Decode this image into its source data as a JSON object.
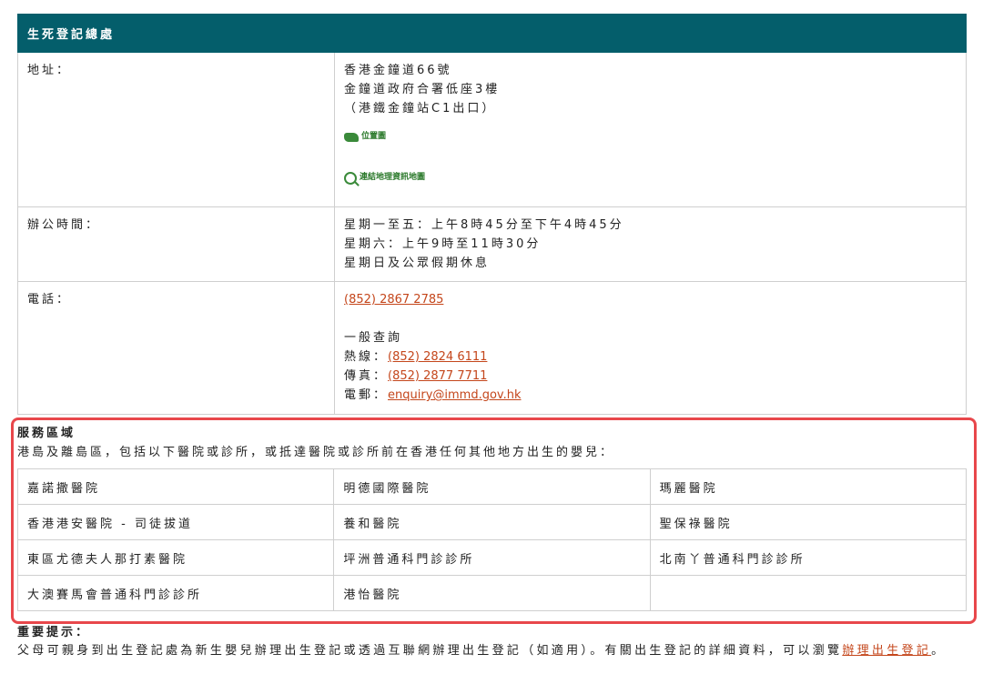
{
  "office": {
    "title": "生死登記總處",
    "address_label": "地址：",
    "address_lines": [
      "香港金鐘道66號",
      "金鐘道政府合署低座3樓",
      "（港鐵金鐘站C1出口）"
    ],
    "map_link": "位置圖",
    "geo_link": "連結地理資訊地圖",
    "hours_label": "辦公時間：",
    "hours_lines": [
      "星期一至五：上午8時45分至下午4時45分",
      "星期六：上午9時至11時30分",
      "星期日及公眾假期休息"
    ],
    "phone_label": "電話：",
    "phone": "(852) 2867 2785",
    "enquiry_title": "一般查詢",
    "hotline_label": "熱線：",
    "hotline": "(852) 2824 6111",
    "fax_label": "傳真：",
    "fax": "(852) 2877 7711",
    "email_label": "電郵：",
    "email": "enquiry@immd.gov.hk"
  },
  "service_area": {
    "heading": "服務區域",
    "description": "港島及離島區，包括以下醫院或診所，或抵達醫院或診所前在香港任何其他地方出生的嬰兒：",
    "hospitals": [
      [
        "嘉諾撒醫院",
        "明德國際醫院",
        "瑪麗醫院"
      ],
      [
        "香港港安醫院 - 司徒拔道",
        "養和醫院",
        "聖保祿醫院"
      ],
      [
        "東區尤德夫人那打素醫院",
        "坪洲普通科門診診所",
        "北南丫普通科門診診所"
      ],
      [
        "大澳賽馬會普通科門診診所",
        "港怡醫院",
        ""
      ]
    ]
  },
  "notice": {
    "heading": "重要提示：",
    "text_before": "父母可親身到出生登記處為新生嬰兒辦理出生登記或透過互聯網辦理出生登記（如適用）。有關出生登記的詳細資料，可以瀏覽",
    "link": "辦理出生登記",
    "text_after": "。"
  },
  "colors": {
    "header_bg": "#045e6b",
    "link": "#c4461b",
    "highlight_border": "#e8474b"
  }
}
